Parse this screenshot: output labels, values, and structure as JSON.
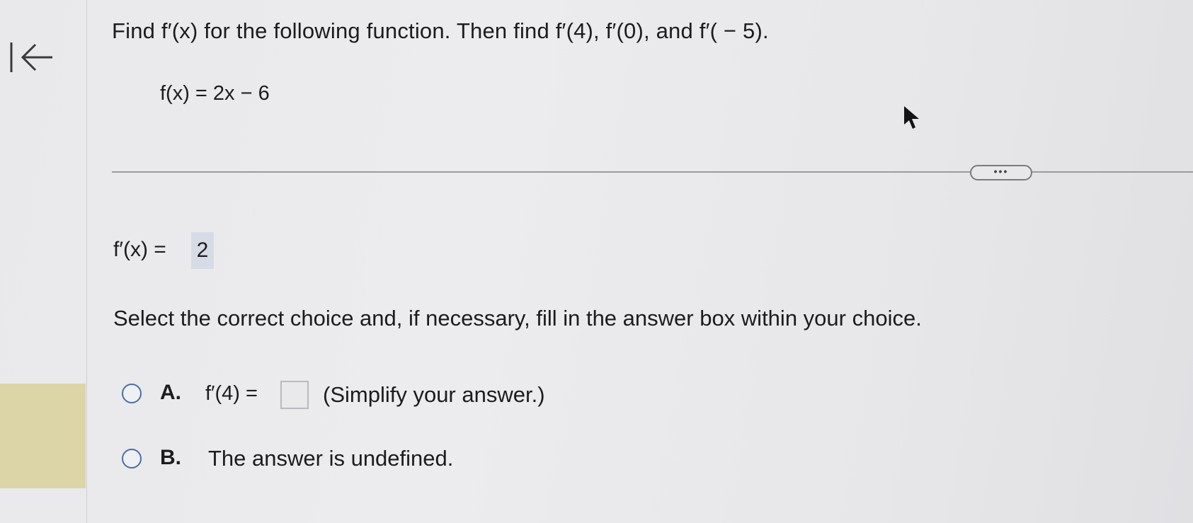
{
  "question": {
    "prompt": "Find f′(x) for the following function. Then find f′(4), f′(0), and f′( − 5).",
    "function": "f(x) = 2x − 6"
  },
  "toolbar": {
    "more_label": "•••"
  },
  "derivative": {
    "label": "f′(x) =",
    "answer": "2"
  },
  "instruction": "Select the correct choice and, if necessary, fill in the answer box within your choice.",
  "choices": [
    {
      "letter": "A.",
      "expression": "f′(4) =",
      "answer_value": "",
      "note": "(Simplify your answer.)"
    },
    {
      "letter": "B.",
      "text": "The answer is undefined."
    }
  ],
  "colors": {
    "radio_border": "#4a6fa8",
    "answer_highlight": "#d6dbe5",
    "left_panel_highlight": "#dcd5a8"
  },
  "icons": {
    "back": "arrow-left-to-bar-icon",
    "cursor": "mouse-pointer-icon",
    "more": "ellipsis-icon"
  }
}
